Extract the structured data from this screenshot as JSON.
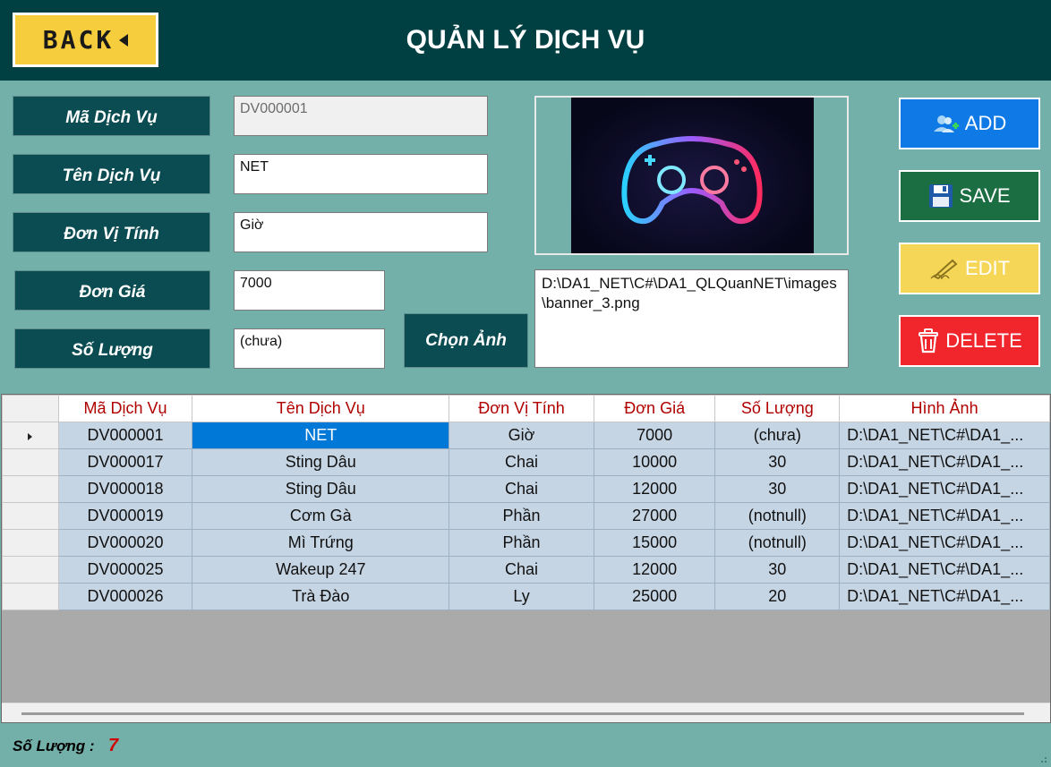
{
  "header": {
    "back_label": "BACK",
    "title": "QUẢN LÝ DỊCH VỤ"
  },
  "form": {
    "ma_label": "Mã Dịch Vụ",
    "ma_value": "DV000001",
    "ten_label": "Tên Dịch Vụ",
    "ten_value": "NET",
    "dvt_label": "Đơn Vị Tính",
    "dvt_value": "Giờ",
    "gia_label": "Đơn Giá",
    "gia_value": "7000",
    "sl_label": "Số Lượng",
    "sl_value": "(chưa)",
    "choose_image_label": "Chọn Ảnh",
    "image_path": "D:\\DA1_NET\\C#\\DA1_QLQuanNET\\images\\banner_3.png",
    "image_icon": "gamepad-image"
  },
  "actions": {
    "add": "ADD",
    "save": "SAVE",
    "edit": "EDIT",
    "delete": "DELETE"
  },
  "grid": {
    "columns": [
      "Mã Dịch Vụ",
      "Tên Dịch Vụ",
      "Đơn Vị Tính",
      "Đơn Giá",
      "Số Lượng",
      "Hình Ảnh"
    ],
    "rows": [
      [
        "DV000001",
        "NET",
        "Giờ",
        "7000",
        "(chưa)",
        "D:\\DA1_NET\\C#\\DA1_..."
      ],
      [
        "DV000017",
        "Sting Dâu",
        "Chai",
        "10000",
        "30",
        "D:\\DA1_NET\\C#\\DA1_..."
      ],
      [
        "DV000018",
        "Sting Dâu",
        "Chai",
        "12000",
        "30",
        "D:\\DA1_NET\\C#\\DA1_..."
      ],
      [
        "DV000019",
        "Cơm Gà",
        "Phần",
        "27000",
        "(notnull)",
        "D:\\DA1_NET\\C#\\DA1_..."
      ],
      [
        "DV000020",
        "Mì Trứng",
        "Phần",
        "15000",
        "(notnull)",
        "D:\\DA1_NET\\C#\\DA1_..."
      ],
      [
        "DV000025",
        "Wakeup 247",
        "Chai",
        "12000",
        "30",
        "D:\\DA1_NET\\C#\\DA1_..."
      ],
      [
        "DV000026",
        "Trà Đào",
        "Ly",
        "25000",
        "20",
        "D:\\DA1_NET\\C#\\DA1_..."
      ]
    ],
    "selected_row": 0
  },
  "footer": {
    "count_label": "Số Lượng :",
    "count_value": "7"
  },
  "colors": {
    "header_bg": "#003f42",
    "panel_bg": "#74b0aa",
    "label_bg": "#0b4c52",
    "back_btn": "#f6cd3c",
    "add": "#0f7ae5",
    "save": "#1b6e42",
    "edit": "#f5d656",
    "delete": "#f0262c",
    "selection": "#0078d7",
    "grid_header_text": "#b00000",
    "count_value": "#d20000"
  }
}
